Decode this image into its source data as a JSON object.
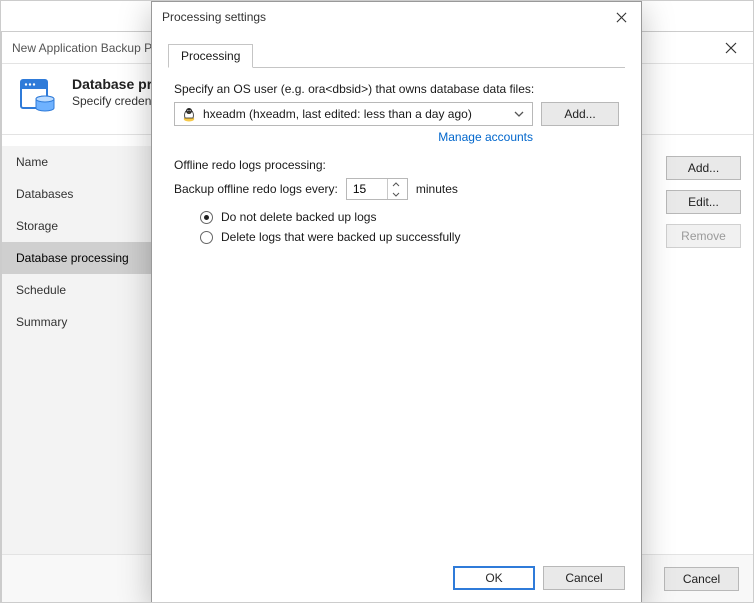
{
  "wizard": {
    "title": "New Application Backup Policy",
    "header_title": "Database processing",
    "header_subtitle": "Specify credentials",
    "nav": [
      "Name",
      "Databases",
      "Storage",
      "Database processing",
      "Schedule",
      "Summary"
    ],
    "nav_selected_index": 3,
    "side_buttons": {
      "add": "Add...",
      "edit": "Edit...",
      "remove": "Remove"
    },
    "footer": {
      "cancel": "Cancel"
    }
  },
  "dialog": {
    "title": "Processing settings",
    "tab_label": "Processing",
    "os_user_label": "Specify an OS user (e.g. ora<dbsid>) that owns database data files:",
    "combo_text": "hxeadm (hxeadm, last edited: less than a day ago)",
    "add_button": "Add...",
    "manage_accounts": "Manage accounts",
    "redo_section": "Offline redo logs processing:",
    "redo_interval_label": "Backup offline redo logs every:",
    "redo_interval_value": "15",
    "redo_interval_unit": "minutes",
    "radio_keep": "Do not delete backed up logs",
    "radio_delete": "Delete logs that were backed up successfully",
    "radio_selected": "keep",
    "ok": "OK",
    "cancel": "Cancel"
  }
}
